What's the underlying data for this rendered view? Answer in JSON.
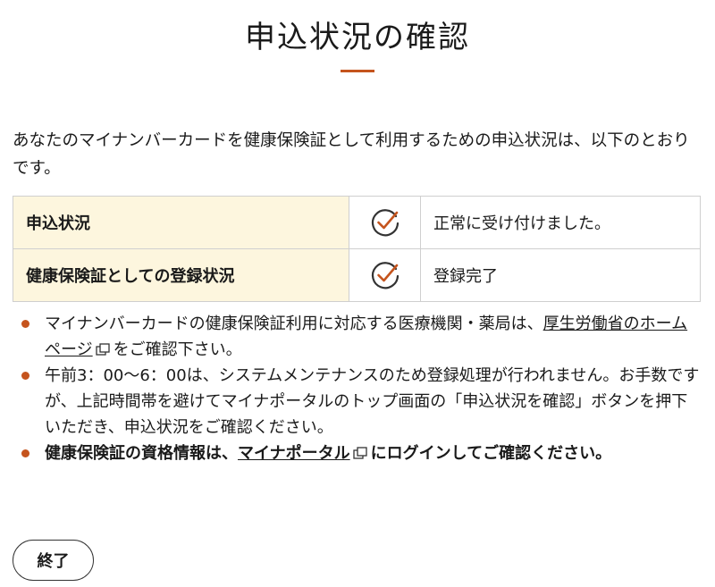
{
  "header": {
    "title": "申込状況の確認"
  },
  "intro": "あなたのマイナンバーカードを健康保険証として利用するための申込状況は、以下のとおりです。",
  "status_table": {
    "rows": [
      {
        "label": "申込状況",
        "icon": "check-circle-icon",
        "value": "正常に受け付けました。"
      },
      {
        "label": "健康保険証としての登録状況",
        "icon": "check-circle-icon",
        "value": "登録完了"
      }
    ]
  },
  "notes": {
    "note1_text": "マイナンバーカードの健康保険証利用に対応する医療機関・薬局は、",
    "note1_link": "厚生労働省のホームページ",
    "note1_suffix": "をご確認下さい。",
    "note2_text": "午前3：00〜6：00は、システムメンテナンスのため登録処理が行われません。お手数ですが、上記時間帯を避けてマイナポータルのトップ画面の「申込状況を確認」ボタンを押下いただき、申込状況をご確認ください。",
    "note3_text": "健康保険証の資格情報は、",
    "note3_link": "マイナポータル",
    "note3_suffix": "にログインしてご確認ください。"
  },
  "footer": {
    "end_label": "終了"
  },
  "colors": {
    "accent": "#c5541d",
    "header_cell_bg": "#fdf6de",
    "check_circle": "#333333"
  }
}
